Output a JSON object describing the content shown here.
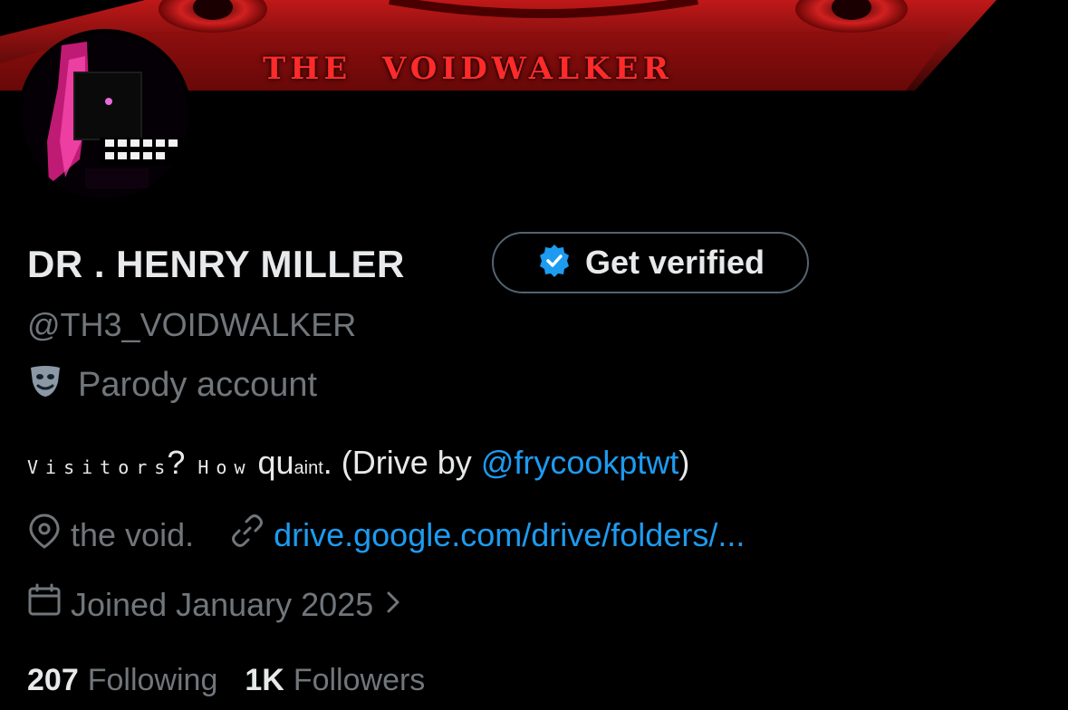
{
  "banner": {
    "title": "THE  VOIDWALKER"
  },
  "profile": {
    "display_name": "DR . HENRY MILLER",
    "handle": "@TH3_VOIDWALKER",
    "parody_label": "Parody account",
    "verify_button_label": "Get verified"
  },
  "bio": {
    "part1": "Visitors",
    "part2": "?",
    "part3": "How",
    "q_base": "qu",
    "q_sup1": "a",
    "q_sup2": "int",
    "part4": ". (Drive by",
    "mention": "@frycookptwt",
    "part5": ")"
  },
  "meta": {
    "location": "the void.",
    "url": "drive.google.com/drive/folders/...",
    "joined": "Joined January 2025"
  },
  "stats": {
    "following_count": "207",
    "following_label": "Following",
    "followers_count": "1K",
    "followers_label": "Followers"
  },
  "colors": {
    "accent": "#1d9bf0",
    "muted": "#71767b",
    "text": "#e7e9ea",
    "banner_red": "#b31010"
  },
  "icons": [
    "shield-check-icon",
    "theater-mask-icon",
    "location-pin-icon",
    "link-icon",
    "calendar-icon",
    "chevron-right-icon"
  ]
}
